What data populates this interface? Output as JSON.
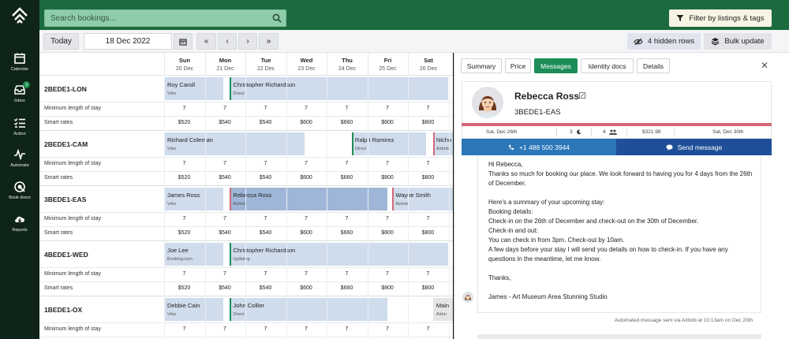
{
  "nav": {
    "items": [
      {
        "label": "Calendar",
        "icon": "calendar-icon"
      },
      {
        "label": "Inbox",
        "icon": "inbox-icon",
        "badge": "3"
      },
      {
        "label": "Action",
        "icon": "checklist-icon"
      },
      {
        "label": "Automate",
        "icon": "pulse-icon"
      },
      {
        "label": "Book direct",
        "icon": "book-direct-icon"
      },
      {
        "label": "Reports",
        "icon": "cloud-download-icon"
      }
    ]
  },
  "topbar": {
    "search_placeholder": "Search bookings...",
    "filter_label": "Filter by listings & tags"
  },
  "toolbar": {
    "today_label": "Today",
    "date_value": "18 Dec 2022",
    "hidden_rows_label": "4 hidden rows",
    "bulk_update_label": "Bulk update"
  },
  "calendar": {
    "days": [
      {
        "name": "Sun",
        "date": "20 Dec"
      },
      {
        "name": "Mon",
        "date": "21 Dec"
      },
      {
        "name": "Tue",
        "date": "22 Dec"
      },
      {
        "name": "Wed",
        "date": "23 Dec"
      },
      {
        "name": "Thu",
        "date": "24 Dec"
      },
      {
        "name": "Fri",
        "date": "25 Dec"
      },
      {
        "name": "Sat",
        "date": "26 Dec"
      }
    ],
    "row_labels": {
      "min_stay": "Minimum length of stay",
      "smart_rates": "Smart rates"
    },
    "properties": [
      {
        "name": "2BEDE1-LON",
        "min_stay": [
          "7",
          "7",
          "7",
          "7",
          "7",
          "7",
          "7"
        ],
        "rates": [
          "$520",
          "$540",
          "$540",
          "$600",
          "$660",
          "$800",
          "$800"
        ],
        "bookings": [
          {
            "guest": "Roy Caroll",
            "channel": "Vrbo",
            "start": 0,
            "span": 1.45,
            "edge": "",
            "style": "light"
          },
          {
            "guest": "Christopher Richardson",
            "channel": "Direct",
            "start": 1.62,
            "span": 5.38,
            "edge": "#1c8d57",
            "style": "light"
          }
        ]
      },
      {
        "name": "2BEDE1-CAM",
        "min_stay": [
          "7",
          "7",
          "7",
          "7",
          "7",
          "7",
          "7"
        ],
        "rates": [
          "$520",
          "$540",
          "$540",
          "$600",
          "$660",
          "$800",
          "$800"
        ],
        "bookings": [
          {
            "guest": "Richard Coleman",
            "channel": "Vrbo",
            "start": 0,
            "span": 3.45,
            "edge": "",
            "style": "light"
          },
          {
            "guest": "Ralph Ramirez",
            "channel": "Direct",
            "start": 4.62,
            "span": 1.83,
            "edge": "#1c8d57",
            "style": "light"
          },
          {
            "guest": "Nicho",
            "channel": "Airbnb",
            "start": 6.62,
            "span": 0.6,
            "edge": "#d16878",
            "style": "light"
          }
        ]
      },
      {
        "name": "3BEDE1-EAS",
        "min_stay": [
          "7",
          "7",
          "7",
          "7",
          "7",
          "7",
          "7"
        ],
        "rates": [
          "$520",
          "$540",
          "$540",
          "$600",
          "$660",
          "$800",
          "$800"
        ],
        "bookings": [
          {
            "guest": "James Ross",
            "channel": "Vrbo",
            "start": 0,
            "span": 1.45,
            "edge": "",
            "style": "light"
          },
          {
            "guest": "Rebecca Ross",
            "channel": "Airbnb",
            "start": 1.62,
            "span": 3.88,
            "edge": "#d16878",
            "style": "dark"
          },
          {
            "guest": "Wayne Smith",
            "channel": "Airbnb",
            "start": 5.62,
            "span": 1.5,
            "edge": "#d16878",
            "style": "light"
          }
        ]
      },
      {
        "name": "4BEDE1-WED",
        "min_stay": [
          "7",
          "7",
          "7",
          "7",
          "7",
          "7",
          "7"
        ],
        "rates": [
          "$520",
          "$540",
          "$540",
          "$600",
          "$660",
          "$800",
          "$800"
        ],
        "bookings": [
          {
            "guest": "Joe Lee",
            "channel": "Booking.com",
            "start": 0,
            "span": 1.45,
            "edge": "",
            "style": "light"
          },
          {
            "guest": "Christopher Richardson",
            "channel": "Upllsting",
            "start": 1.62,
            "span": 5.38,
            "edge": "#1c8d57",
            "style": "light"
          }
        ]
      },
      {
        "name": "1BEDE1-OX",
        "min_stay": [
          "7",
          "7",
          "7",
          "7",
          "7",
          "7",
          "7"
        ],
        "rates": [],
        "bookings": [
          {
            "guest": "Debbie Cain",
            "channel": "Vrbo",
            "start": 0,
            "span": 1.45,
            "edge": "",
            "style": "light"
          },
          {
            "guest": "John Collier",
            "channel": "Direct",
            "start": 1.62,
            "span": 3.88,
            "edge": "#1c8d57",
            "style": "light"
          },
          {
            "guest": "Main",
            "channel": "Airbn",
            "start": 6.62,
            "span": 0.6,
            "edge": "",
            "style": "gray"
          }
        ]
      }
    ]
  },
  "panel": {
    "tabs": [
      "Summary",
      "Price",
      "Messages",
      "Identity docs",
      "Details"
    ],
    "active_tab": "Messages",
    "guest_name": "Rebecca Ross",
    "property": "3BEDE1-EAS",
    "meta": {
      "checkin": "Sat, Dec 26th",
      "nights": "3",
      "guests": "4",
      "total": "$321.98",
      "checkout": "Sat, Dec 30th"
    },
    "call_label": "+1 488 500 3944",
    "send_label": "Send message",
    "message": "Hi Rebecca,\nThanks so much for booking our place. We look forward to having you for 4 days from the 26th of December.\n\nHere's a summary of your upcoming stay:\nBooking details:\nCheck-in on the 26th of December and check-out on the 30th of December.\nCheck-in and out:\nYou can check in from 3pm. Check-out by 10am.\nA few days before your stay I will send you details on how to check-in. If you have any questions in the meantime, let me know.\n\nThanks,\n\nJames - Art Museum Area Stunning Studio",
    "auto_note": "Automated message sent via Airbnb at 10:13am on Dec 20th"
  },
  "colors": {
    "brand_green": "#1c6b3f",
    "active_tab": "#1c8d57",
    "airbnb_edge": "#d16878",
    "direct_edge": "#1c8d57",
    "call_blue": "#2b77b8",
    "message_blue": "#1f4f98"
  }
}
